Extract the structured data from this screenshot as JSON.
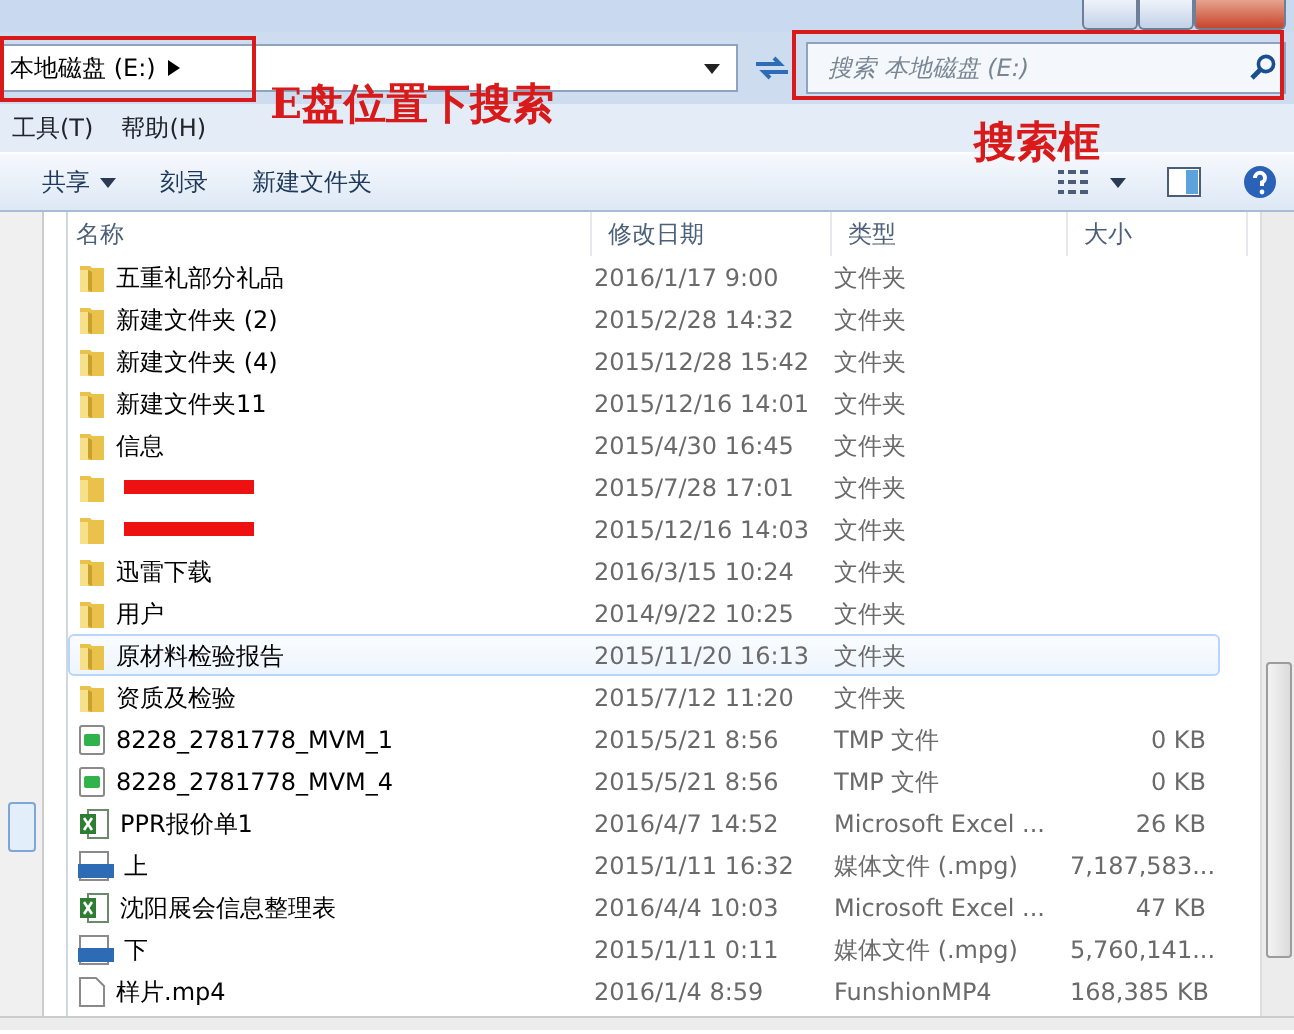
{
  "address": {
    "path": "本地磁盘 (E:)"
  },
  "search": {
    "placeholder": "搜索 本地磁盘 (E:)"
  },
  "menu": [
    "工具(T)",
    "帮助(H)"
  ],
  "toolbar": [
    {
      "label": "共享",
      "kind": "dropdown"
    },
    {
      "label": "刻录",
      "kind": "plain"
    },
    {
      "label": "新建文件夹",
      "kind": "plain"
    }
  ],
  "columns": [
    "名称",
    "修改日期",
    "类型",
    "大小"
  ],
  "rows": [
    {
      "kind": "folder",
      "name": "五重礼部分礼品",
      "date": "2016/1/17 9:00",
      "type": "文件夹",
      "hovered": false
    },
    {
      "kind": "folder",
      "name": "新建文件夹 (2)",
      "date": "2015/2/28 14:32",
      "type": "文件夹",
      "hovered": false
    },
    {
      "kind": "folder",
      "name": "新建文件夹 (4)",
      "date": "2015/12/28 15:42",
      "type": "文件夹",
      "hovered": false
    },
    {
      "kind": "folder",
      "name": "新建文件夹11",
      "date": "2015/12/16 14:01",
      "type": "文件夹",
      "hovered": false
    },
    {
      "kind": "folder",
      "name": "信息",
      "date": "2015/4/30 16:45",
      "type": "文件夹",
      "hovered": false
    },
    {
      "kind": "redacted",
      "date": "2015/7/28 17:01",
      "type": "文件夹",
      "hovered": false
    },
    {
      "kind": "redacted",
      "date": "2015/12/16 14:03",
      "type": "文件夹",
      "hovered": false
    },
    {
      "kind": "folder",
      "name": "迅雷下载",
      "date": "2016/3/15 10:24",
      "type": "文件夹",
      "hovered": false
    },
    {
      "kind": "folder",
      "name": "用户",
      "date": "2014/9/22 10:25",
      "type": "文件夹",
      "hovered": false
    },
    {
      "kind": "folder",
      "name": "原材料检验报告",
      "date": "2015/11/20 16:13",
      "type": "文件夹",
      "hovered": true
    },
    {
      "kind": "folder",
      "name": "资质及检验",
      "date": "2015/7/12 11:20",
      "type": "文件夹",
      "hovered": false
    },
    {
      "kind": "tmp",
      "name": "8228_2781778_MVM_1",
      "date": "2015/5/21 8:56",
      "type": "TMP 文件",
      "size": "0 KB",
      "hovered": false
    },
    {
      "kind": "tmp",
      "name": "8228_2781778_MVM_4",
      "date": "2015/5/21 8:56",
      "type": "TMP 文件",
      "size": "0 KB",
      "hovered": false
    },
    {
      "kind": "excel",
      "name": "PPR报价单1",
      "date": "2016/4/7 14:52",
      "type": "Microsoft Excel ...",
      "size": "26 KB",
      "hovered": false
    },
    {
      "kind": "video",
      "name": "上",
      "date": "2015/1/11 16:32",
      "type": "媒体文件 (.mpg)",
      "size": "7,187,583...",
      "hovered": false
    },
    {
      "kind": "excel",
      "name": "沈阳展会信息整理表",
      "date": "2016/4/4 10:03",
      "type": "Microsoft Excel ...",
      "size": "47 KB",
      "hovered": false
    },
    {
      "kind": "video",
      "name": "下",
      "date": "2015/1/11 0:11",
      "type": "媒体文件 (.mpg)",
      "size": "5,760,141...",
      "hovered": false
    },
    {
      "kind": "file",
      "name": "样片.mp4",
      "date": "2016/1/4 8:59",
      "type": "FunshionMP4",
      "size": "168,385 KB",
      "hovered": false
    }
  ],
  "annotations": [
    "E盘位置下搜索",
    "搜索框"
  ]
}
